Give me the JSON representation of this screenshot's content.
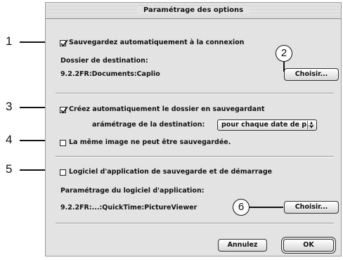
{
  "dialog": {
    "title": "Paramétrage des options",
    "auto_save": {
      "label": "Sauvegardez automatiquement à la connexion",
      "checked": true,
      "dest_folder_label": "Dossier de destination:",
      "dest_folder_path": "9.2.2FR:Documents:Caplio",
      "choose_button": "Choisir..."
    },
    "auto_create": {
      "label": "Créez automatiquement le dossier en sauvegardant",
      "checked": true,
      "param_label": "arámétrage de la destination:",
      "param_value": "pour chaque date de p...",
      "param_arrow": "⇕"
    },
    "same_image": {
      "label": "La même image ne peut être sauvegardée.",
      "checked": false
    },
    "app_software": {
      "label": "Logiciel d'application de sauvegarde et de démarrage",
      "checked": false,
      "param_label": "Paramétrage du logiciel d'application:",
      "path": "9.2.2FR:...:QuickTime:PictureViewer",
      "choose_button": "Choisir..."
    },
    "cancel_button": "Annulez",
    "ok_button": "OK"
  },
  "callouts": [
    "1",
    "2",
    "3",
    "4",
    "5",
    "6"
  ]
}
